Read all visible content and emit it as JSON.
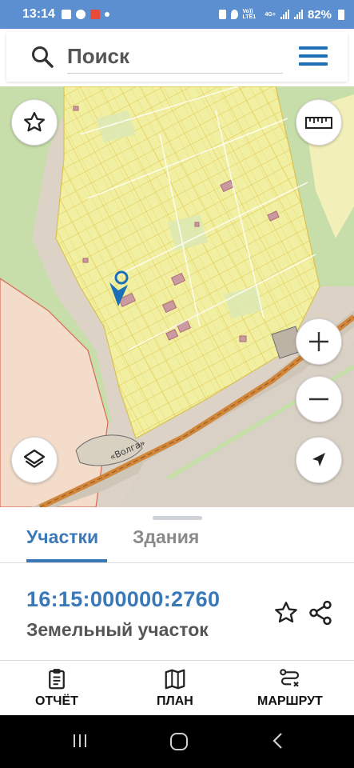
{
  "status_bar": {
    "time": "13:14",
    "network_label": "Vo)) LTE1",
    "network_gen": "4G+",
    "battery": "82%"
  },
  "search": {
    "placeholder": "Поиск"
  },
  "map": {
    "road_label": "«Волга»",
    "buttons": {
      "favorite": "star-icon",
      "measure": "ruler-icon",
      "layers": "layers-icon",
      "zoom_in": "plus-icon",
      "zoom_out": "minus-icon",
      "locate": "navigation-arrow-icon"
    },
    "colors": {
      "parcel_fill": "#f1f0a2",
      "parcel_line": "#e0c64c",
      "forest": "#c7deaa",
      "residential": "#f4dccb",
      "road": "#d2863a",
      "marker": "#1d6fb5"
    }
  },
  "tabs": [
    {
      "label": "Участки",
      "active": true
    },
    {
      "label": "Здания",
      "active": false
    }
  ],
  "parcel": {
    "cadastral_number": "16:15:000000:2760",
    "type": "Земельный участок"
  },
  "bottom_nav": [
    {
      "label": "ОТЧЁТ",
      "icon": "clipboard-icon"
    },
    {
      "label": "ПЛАН",
      "icon": "map-icon"
    },
    {
      "label": "МАРШРУТ",
      "icon": "route-icon"
    }
  ],
  "system_nav": [
    "recents-icon",
    "home-icon",
    "back-icon"
  ]
}
